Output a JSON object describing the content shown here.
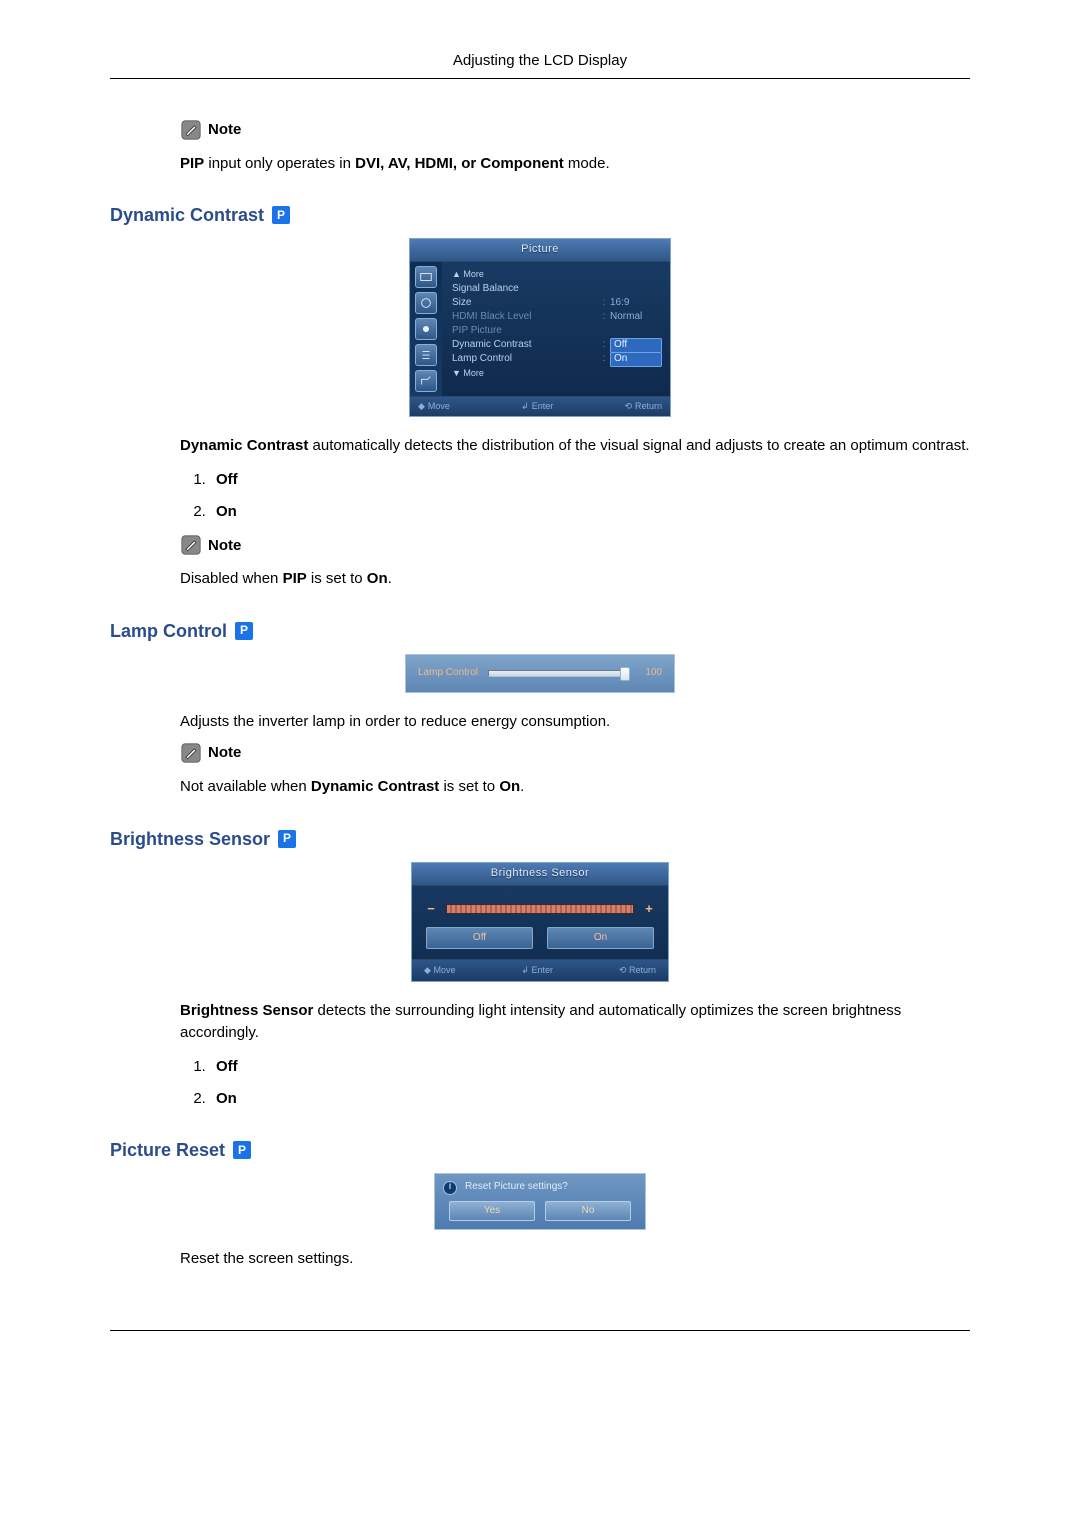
{
  "page": {
    "header": "Adjusting the LCD Display"
  },
  "notes": {
    "label": "Note",
    "pip_input_prefix": "PIP",
    "pip_input_mid": " input only operates in ",
    "pip_input_modes": "DVI, AV, HDMI, or Component",
    "pip_input_suffix": " mode.",
    "disabled_pip_prefix": "Disabled when ",
    "disabled_pip_bold1": "PIP",
    "disabled_pip_mid": " is set to ",
    "disabled_pip_bold2": "On",
    "disabled_pip_suffix": ".",
    "not_avail_prefix": "Not available when ",
    "not_avail_bold": "Dynamic Contrast",
    "not_avail_mid": " is set to ",
    "not_avail_bold2": "On",
    "not_avail_suffix": "."
  },
  "sections": {
    "dynamic_contrast": {
      "title": "Dynamic Contrast",
      "desc_bold": "Dynamic Contrast",
      "desc_rest": " automatically detects the distribution of the visual signal and adjusts to create an optimum contrast.",
      "options": [
        "Off",
        "On"
      ]
    },
    "lamp_control": {
      "title": "Lamp Control",
      "desc": "Adjusts the inverter lamp in order to reduce energy consumption."
    },
    "brightness_sensor": {
      "title": "Brightness Sensor",
      "desc_bold": "Brightness Sensor",
      "desc_rest": " detects the surrounding light intensity and automatically optimizes the screen brightness accordingly.",
      "options": [
        "Off",
        "On"
      ]
    },
    "picture_reset": {
      "title": "Picture Reset",
      "desc": "Reset the screen settings."
    }
  },
  "osd_picture": {
    "title": "Picture",
    "more_up": "▲ More",
    "more_down": "▼ More",
    "rows": {
      "signal_balance": "Signal Balance",
      "size_label": "Size",
      "size_value": "16:9",
      "hdmi_label": "HDMI Black Level",
      "hdmi_value": "Normal",
      "pip_label": "PIP Picture",
      "dc_label": "Dynamic Contrast",
      "dc_value": "Off",
      "lc_label": "Lamp Control",
      "lc_value": "On"
    },
    "footer": {
      "move": "Move",
      "enter": "Enter",
      "return": "Return"
    }
  },
  "osd_lamp": {
    "label": "Lamp Control",
    "value": "100"
  },
  "osd_bs": {
    "title": "Brightness Sensor",
    "minus": "−",
    "plus": "+",
    "off": "Off",
    "on": "On",
    "footer": {
      "move": "Move",
      "enter": "Enter",
      "return": "Return"
    }
  },
  "osd_pr": {
    "prompt": "Reset Picture settings?",
    "yes": "Yes",
    "no": "No"
  },
  "badge": {
    "p": "P"
  },
  "footer_glyphs": {
    "move": "◆",
    "enter": "↲",
    "return": "⟲"
  }
}
